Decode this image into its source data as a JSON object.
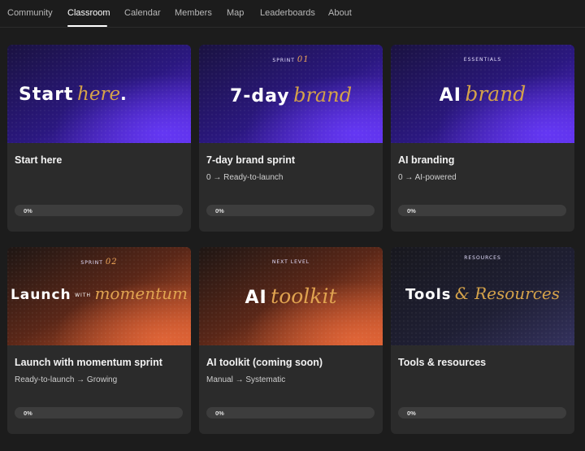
{
  "nav": {
    "tabs": [
      {
        "label": "Community"
      },
      {
        "label": "Classroom",
        "active": true
      },
      {
        "label": "Calendar"
      },
      {
        "label": "Members"
      },
      {
        "label": "Map"
      },
      {
        "label": "Leaderboards"
      },
      {
        "label": "About"
      }
    ]
  },
  "courses": [
    {
      "banner": {
        "theme": "purple",
        "kicker": "",
        "kicker_num": "",
        "title_sans": "Start",
        "title_mid": "",
        "title_serif": "here",
        "title_suffix": "."
      },
      "title": "Start here",
      "subtitle": "",
      "progress": 0,
      "progress_label": "0%"
    },
    {
      "banner": {
        "theme": "purple",
        "kicker": "SPRINT",
        "kicker_num": "01",
        "title_sans": "7-day",
        "title_mid": "",
        "title_serif": "brand",
        "title_suffix": ""
      },
      "title": "7-day brand sprint",
      "subtitle": "0 → Ready-to-launch",
      "progress": 0,
      "progress_label": "0%"
    },
    {
      "banner": {
        "theme": "purple",
        "kicker": "ESSENTIALS",
        "kicker_num": "",
        "title_sans": "AI",
        "title_mid": "",
        "title_serif": "brand",
        "title_suffix": ""
      },
      "title": "AI branding",
      "subtitle": "0 → AI-powered",
      "progress": 0,
      "progress_label": "0%"
    },
    {
      "banner": {
        "theme": "orange",
        "kicker": "SPRINT",
        "kicker_num": "02",
        "title_sans": "Launch",
        "title_mid": "WITH",
        "title_serif": "momentum",
        "title_suffix": ""
      },
      "title": "Launch with momentum sprint",
      "subtitle": "Ready-to-launch → Growing",
      "progress": 0,
      "progress_label": "0%"
    },
    {
      "banner": {
        "theme": "orange",
        "kicker": "NEXT LEVEL",
        "kicker_num": "",
        "title_sans": "AI",
        "title_mid": "",
        "title_serif": "toolkit",
        "title_suffix": ""
      },
      "title": "AI toolkit (coming soon)",
      "subtitle": "Manual → Systematic",
      "progress": 0,
      "progress_label": "0%"
    },
    {
      "banner": {
        "theme": "navy",
        "kicker": "RESOURCES",
        "kicker_num": "",
        "title_sans": "Tools",
        "title_mid": "",
        "title_serif": "& Resources",
        "title_suffix": ""
      },
      "title": "Tools & resources",
      "subtitle": "",
      "progress": 0,
      "progress_label": "0%"
    }
  ],
  "colors": {
    "background": "#1c1c1c",
    "card": "#2b2b2b",
    "purple_banner": "#3a1a9a",
    "orange_banner": "#c0532a",
    "navy_banner": "#23224a",
    "serif_gold": "#d4a24a"
  }
}
